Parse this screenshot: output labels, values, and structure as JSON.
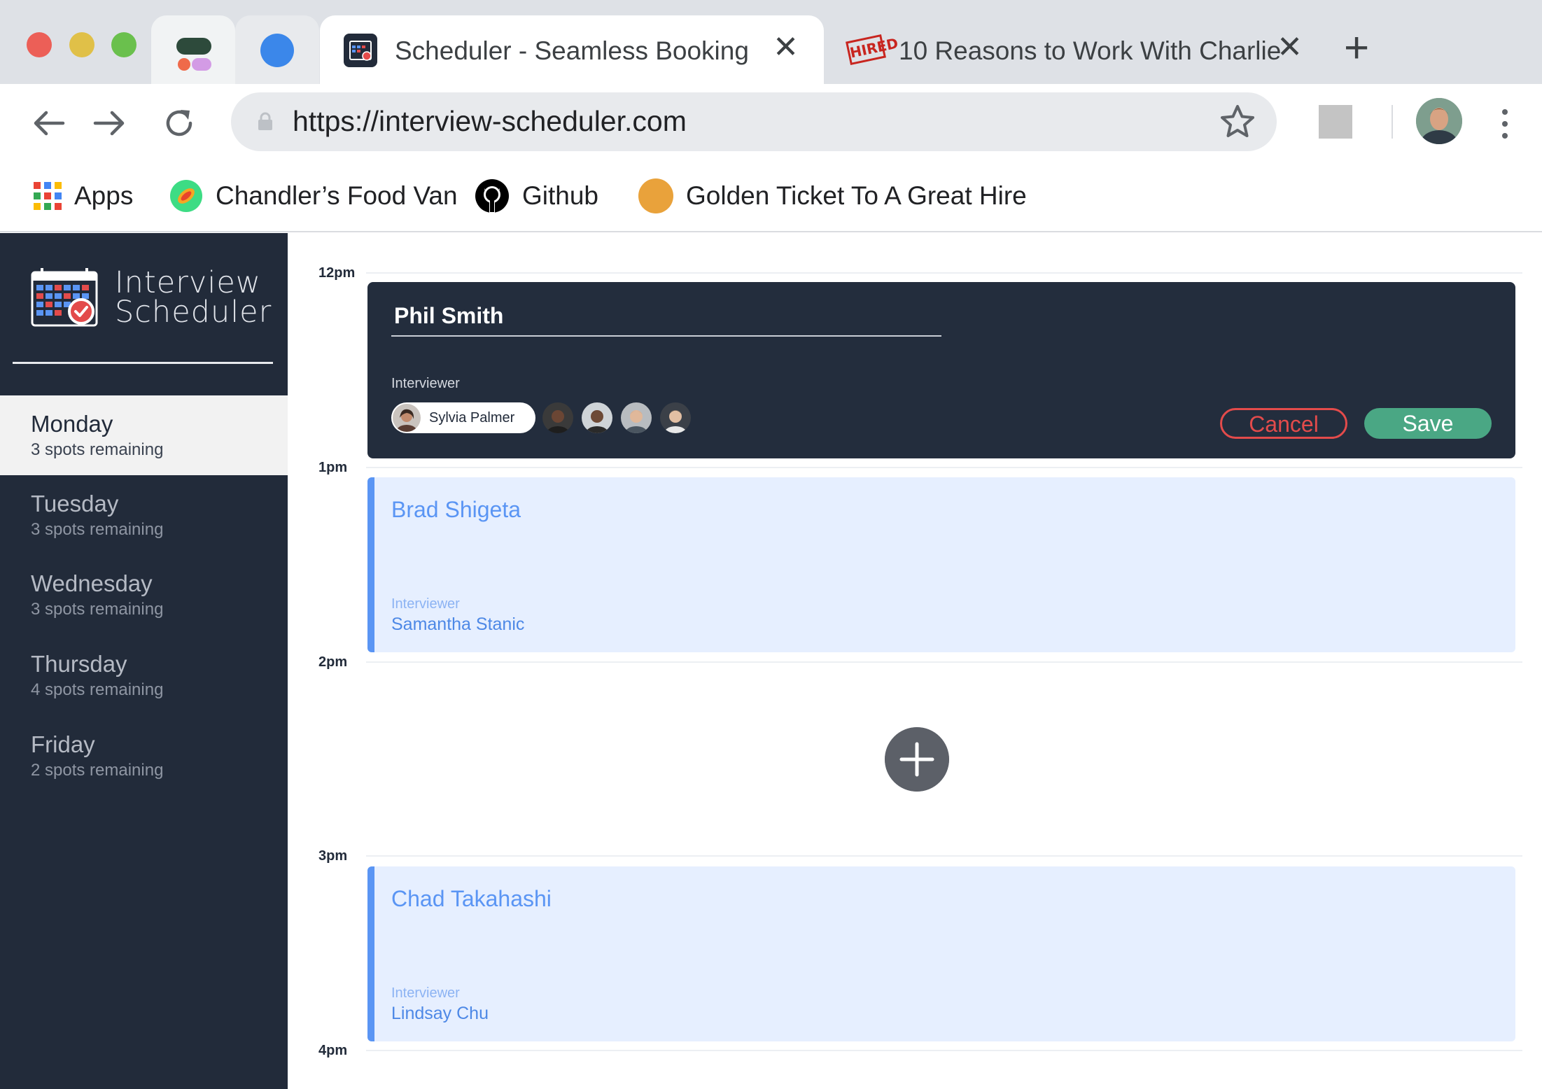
{
  "browser": {
    "tabs": [
      {
        "title": "Scheduler - Seamless Booking",
        "active": true
      },
      {
        "title": "10 Reasons to Work With Charlie",
        "active": false
      }
    ],
    "favicon_badge": "HIRED",
    "url": "https://interview-scheduler.com",
    "bookmarks": [
      {
        "label": "Apps",
        "icon": "apps-grid-icon"
      },
      {
        "label": "Chandler’s Food Van",
        "icon": "food-van-icon"
      },
      {
        "label": "Github",
        "icon": "github-icon"
      },
      {
        "label": "Golden Ticket To A Great Hire",
        "icon": "golden-ticket-icon"
      }
    ]
  },
  "sidebar": {
    "logo_line1": "Interview",
    "logo_line2": "Scheduler",
    "days": [
      {
        "name": "Monday",
        "spots": "3 spots remaining",
        "selected": true
      },
      {
        "name": "Tuesday",
        "spots": "3 spots remaining",
        "selected": false
      },
      {
        "name": "Wednesday",
        "spots": "3 spots remaining",
        "selected": false
      },
      {
        "name": "Thursday",
        "spots": "4 spots remaining",
        "selected": false
      },
      {
        "name": "Friday",
        "spots": "2 spots remaining",
        "selected": false
      }
    ]
  },
  "schedule": {
    "hours": [
      "12pm",
      "1pm",
      "2pm",
      "3pm",
      "4pm"
    ],
    "form": {
      "student_name": "Phil Smith",
      "interviewer_label": "Interviewer",
      "selected_interviewer": "Sylvia Palmer",
      "cancel_label": "Cancel",
      "save_label": "Save"
    },
    "appointments": [
      {
        "student": "Brad Shigeta",
        "interviewer_label": "Interviewer",
        "interviewer": "Samantha Stanic"
      },
      {
        "student": "Chad Takahashi",
        "interviewer_label": "Interviewer",
        "interviewer": "Lindsay Chu"
      }
    ]
  },
  "colors": {
    "sidebar_bg": "#222b3a",
    "form_bg": "#232d3d",
    "appointment_bg": "#e6efff",
    "appointment_accent": "#5a95f4",
    "cancel": "#e34b4b",
    "save": "#4aa784"
  }
}
